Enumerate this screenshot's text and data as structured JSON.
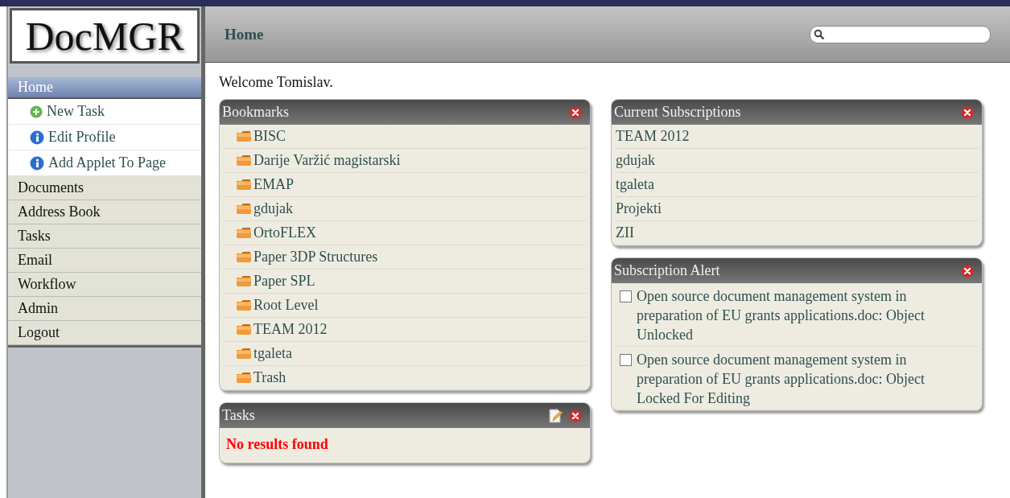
{
  "logo": "DocMGR",
  "sidebar": {
    "items": [
      {
        "label": "Home",
        "kind": "main",
        "selected": true
      },
      {
        "label": "New Task",
        "kind": "sub-add",
        "selected": false
      },
      {
        "label": "Edit Profile",
        "kind": "sub-info",
        "selected": false
      },
      {
        "label": "Add Applet To Page",
        "kind": "sub-info",
        "selected": false
      },
      {
        "label": "Documents",
        "kind": "main",
        "selected": false
      },
      {
        "label": "Address Book",
        "kind": "main",
        "selected": false
      },
      {
        "label": "Tasks",
        "kind": "main",
        "selected": false
      },
      {
        "label": "Email",
        "kind": "main",
        "selected": false
      },
      {
        "label": "Workflow",
        "kind": "main",
        "selected": false
      },
      {
        "label": "Admin",
        "kind": "main",
        "selected": false
      },
      {
        "label": "Logout",
        "kind": "main",
        "selected": false
      }
    ]
  },
  "header": {
    "title": "Home"
  },
  "welcome": "Welcome Tomislav.",
  "columns": [
    [
      {
        "title": "Bookmarks",
        "kind": "folders",
        "items": [
          "BISC",
          "Darije Varžić magistarski",
          "EMAP",
          "gdujak",
          "OrtoFLEX",
          "Paper 3DP Structures",
          "Paper SPL",
          "Root Level",
          "TEAM 2012",
          "tgaleta",
          "Trash"
        ]
      },
      {
        "title": "Tasks",
        "kind": "message",
        "editable": true,
        "message": "No results found"
      }
    ],
    [
      {
        "title": "Current Subscriptions",
        "kind": "links",
        "items": [
          "TEAM 2012",
          "gdujak",
          "tgaleta",
          "Projekti",
          "ZII"
        ]
      },
      {
        "title": "Subscription Alert",
        "kind": "alerts",
        "alerts": [
          {
            "text": "Open source document management system in preparation of EU grants applications.doc: Object Unlocked",
            "checked": false
          },
          {
            "text": "Open source document management system in preparation of EU grants applications.doc: Object Locked For Editing",
            "checked": false
          }
        ]
      }
    ]
  ]
}
